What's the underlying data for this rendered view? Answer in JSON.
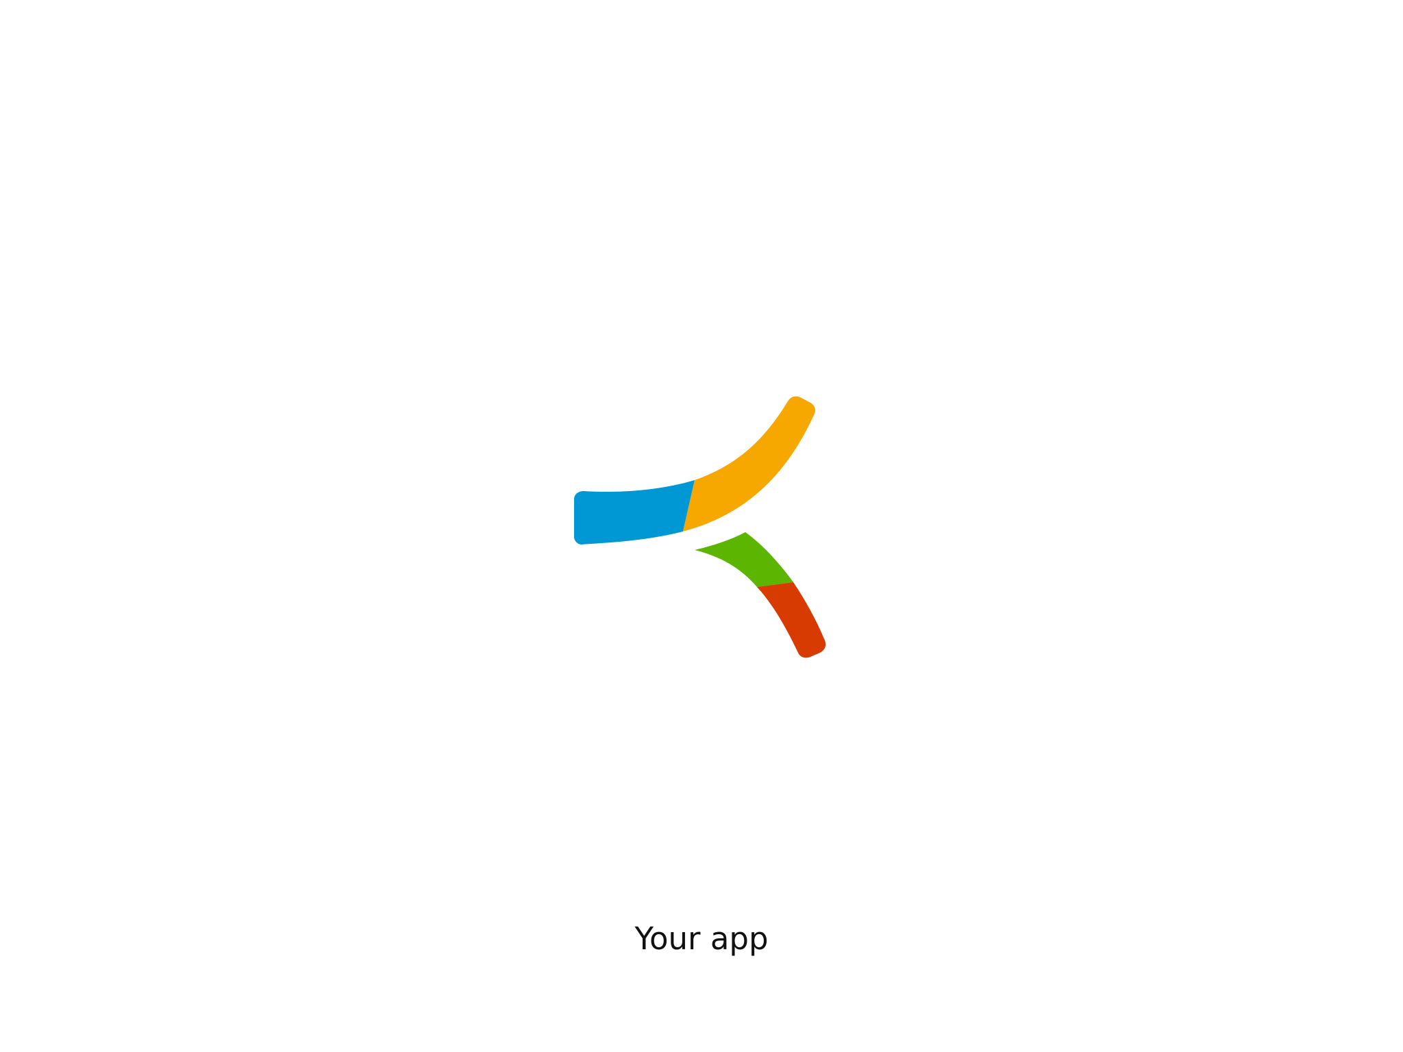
{
  "splash": {
    "app_name": "Your app",
    "logo_icon": "segmented-arrow-logo-icon",
    "background_color": "#ffffff",
    "text_color": "#111111",
    "logo_colors": {
      "blue": "#0098d4",
      "orange": "#f7a800",
      "green": "#5cb500",
      "red": "#d83b01"
    }
  }
}
